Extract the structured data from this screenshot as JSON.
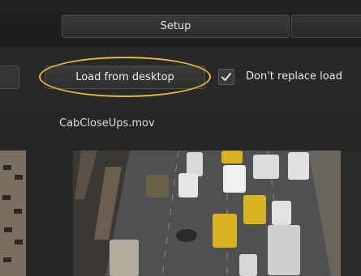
{
  "tabs": {
    "setup_label": "Setup"
  },
  "toolbar": {
    "load_button_label": "Load from desktop",
    "dont_replace_label": "Don't replace load",
    "dont_replace_checked": true
  },
  "file": {
    "name": "CabCloseUps.mov"
  },
  "colors": {
    "background": "#262626",
    "highlight": "#e2b73a",
    "taxi": "#d9b321"
  }
}
